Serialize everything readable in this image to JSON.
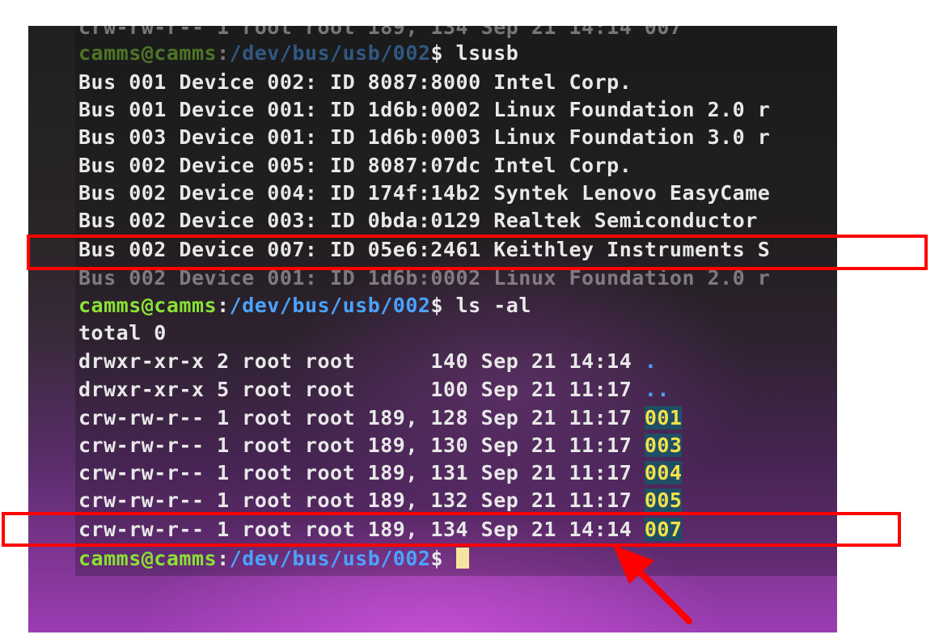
{
  "terminal": {
    "lines": {
      "top_partial": "crw-rw-r-- 1 root root 189, 134 Sep 21 14:14 007",
      "prompt1_user": "camms@camms",
      "prompt1_sep": ":",
      "prompt1_path": "/dev/bus/usb/002",
      "prompt1_cmd": "$ lsusb",
      "usb1": "Bus 001 Device 002: ID 8087:8000 Intel Corp.",
      "usb2": "Bus 001 Device 001: ID 1d6b:0002 Linux Foundation 2.0 r",
      "usb3": "Bus 003 Device 001: ID 1d6b:0003 Linux Foundation 3.0 r",
      "usb4": "Bus 002 Device 005: ID 8087:07dc Intel Corp.",
      "usb5": "Bus 002 Device 004: ID 174f:14b2 Syntek Lenovo EasyCame",
      "usb6": "Bus 002 Device 003: ID 0bda:0129 Realtek Semiconductor",
      "usb7": "Bus 002 Device 007: ID 05e6:2461 Keithley Instruments S",
      "usb8": "Bus 002 Device 001: ID 1d6b:0002 Linux Foundation 2.0 r",
      "prompt2_user": "camms@camms",
      "prompt2_sep": ":",
      "prompt2_path": "/dev/bus/usb/002",
      "prompt2_cmd": "$ ls -al",
      "total": "total 0",
      "ls1_text": "drwxr-xr-x 2 root root      140 Sep 21 14:14 ",
      "ls1_name": ".",
      "ls2_text": "drwxr-xr-x 5 root root      100 Sep 21 11:17 ",
      "ls2_name": "..",
      "ls3_text": "crw-rw-r-- 1 root root 189, 128 Sep 21 11:17 ",
      "ls3_name": "001",
      "ls4_text": "crw-rw-r-- 1 root root 189, 130 Sep 21 11:17 ",
      "ls4_name": "003",
      "ls5_text": "crw-rw-r-- 1 root root 189, 131 Sep 21 11:17 ",
      "ls5_name": "004",
      "ls6_text": "crw-rw-r-- 1 root root 189, 132 Sep 21 11:17 ",
      "ls6_name": "005",
      "ls7_text": "crw-rw-r-- 1 root root 189, 134 Sep 21 14:14 ",
      "ls7_name": "007",
      "prompt3_user": "camms@camms",
      "prompt3_sep": ":",
      "prompt3_path": "/dev/bus/usb/002",
      "prompt3_cmd": "$ "
    }
  },
  "annotations": {
    "highlight_color": "#ff0000",
    "arrow_color": "#ff0000"
  },
  "colors": {
    "prompt_user": "#8ae234",
    "prompt_path": "#4aa3ff",
    "device_name": "#f4e14a",
    "device_bg": "#1f4f66"
  }
}
